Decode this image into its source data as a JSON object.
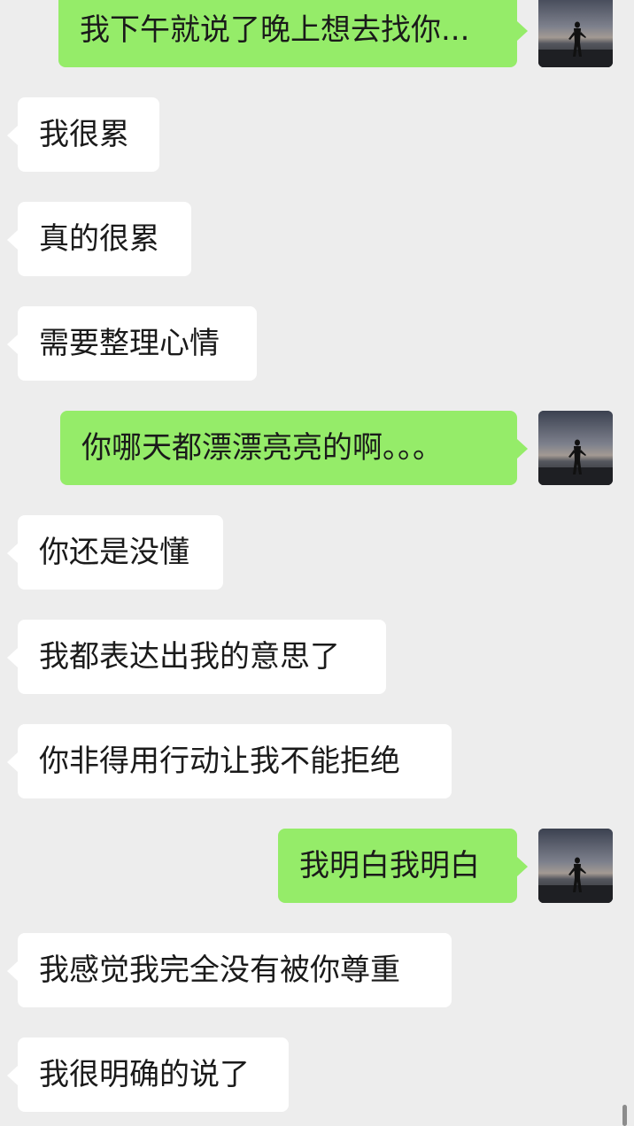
{
  "messages": [
    {
      "side": "right",
      "text": "我下午就说了晚上想去找你..."
    },
    {
      "side": "left",
      "text": "我很累"
    },
    {
      "side": "left",
      "text": "真的很累"
    },
    {
      "side": "left",
      "text": "需要整理心情"
    },
    {
      "side": "right",
      "text": "你哪天都漂漂亮亮的啊。。。"
    },
    {
      "side": "left",
      "text": "你还是没懂"
    },
    {
      "side": "left",
      "text": "我都表达出我的意思了"
    },
    {
      "side": "left",
      "text": "你非得用行动让我不能拒绝"
    },
    {
      "side": "right",
      "text": "我明白我明白"
    },
    {
      "side": "left",
      "text": "我感觉我完全没有被你尊重"
    },
    {
      "side": "left",
      "text": "我很明确的说了"
    }
  ],
  "colors": {
    "background": "#ededed",
    "sent_bubble": "#95ec69",
    "received_bubble": "#ffffff"
  },
  "icons": {
    "avatar": "silhouette-at-dusk-photo"
  }
}
